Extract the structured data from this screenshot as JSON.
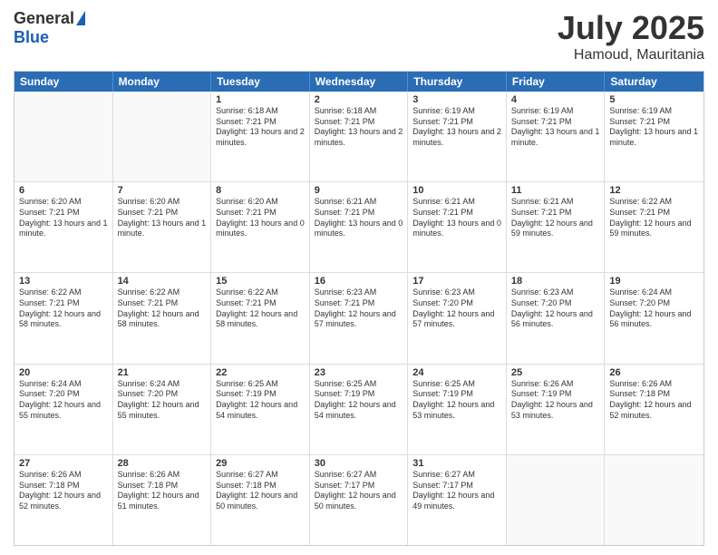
{
  "logo": {
    "general": "General",
    "blue": "Blue"
  },
  "title": "July 2025",
  "subtitle": "Hamoud, Mauritania",
  "header": {
    "days": [
      "Sunday",
      "Monday",
      "Tuesday",
      "Wednesday",
      "Thursday",
      "Friday",
      "Saturday"
    ]
  },
  "rows": [
    [
      {
        "day": "",
        "info": ""
      },
      {
        "day": "",
        "info": ""
      },
      {
        "day": "1",
        "info": "Sunrise: 6:18 AM\nSunset: 7:21 PM\nDaylight: 13 hours and 2 minutes."
      },
      {
        "day": "2",
        "info": "Sunrise: 6:18 AM\nSunset: 7:21 PM\nDaylight: 13 hours and 2 minutes."
      },
      {
        "day": "3",
        "info": "Sunrise: 6:19 AM\nSunset: 7:21 PM\nDaylight: 13 hours and 2 minutes."
      },
      {
        "day": "4",
        "info": "Sunrise: 6:19 AM\nSunset: 7:21 PM\nDaylight: 13 hours and 1 minute."
      },
      {
        "day": "5",
        "info": "Sunrise: 6:19 AM\nSunset: 7:21 PM\nDaylight: 13 hours and 1 minute."
      }
    ],
    [
      {
        "day": "6",
        "info": "Sunrise: 6:20 AM\nSunset: 7:21 PM\nDaylight: 13 hours and 1 minute."
      },
      {
        "day": "7",
        "info": "Sunrise: 6:20 AM\nSunset: 7:21 PM\nDaylight: 13 hours and 1 minute."
      },
      {
        "day": "8",
        "info": "Sunrise: 6:20 AM\nSunset: 7:21 PM\nDaylight: 13 hours and 0 minutes."
      },
      {
        "day": "9",
        "info": "Sunrise: 6:21 AM\nSunset: 7:21 PM\nDaylight: 13 hours and 0 minutes."
      },
      {
        "day": "10",
        "info": "Sunrise: 6:21 AM\nSunset: 7:21 PM\nDaylight: 13 hours and 0 minutes."
      },
      {
        "day": "11",
        "info": "Sunrise: 6:21 AM\nSunset: 7:21 PM\nDaylight: 12 hours and 59 minutes."
      },
      {
        "day": "12",
        "info": "Sunrise: 6:22 AM\nSunset: 7:21 PM\nDaylight: 12 hours and 59 minutes."
      }
    ],
    [
      {
        "day": "13",
        "info": "Sunrise: 6:22 AM\nSunset: 7:21 PM\nDaylight: 12 hours and 58 minutes."
      },
      {
        "day": "14",
        "info": "Sunrise: 6:22 AM\nSunset: 7:21 PM\nDaylight: 12 hours and 58 minutes."
      },
      {
        "day": "15",
        "info": "Sunrise: 6:22 AM\nSunset: 7:21 PM\nDaylight: 12 hours and 58 minutes."
      },
      {
        "day": "16",
        "info": "Sunrise: 6:23 AM\nSunset: 7:21 PM\nDaylight: 12 hours and 57 minutes."
      },
      {
        "day": "17",
        "info": "Sunrise: 6:23 AM\nSunset: 7:20 PM\nDaylight: 12 hours and 57 minutes."
      },
      {
        "day": "18",
        "info": "Sunrise: 6:23 AM\nSunset: 7:20 PM\nDaylight: 12 hours and 56 minutes."
      },
      {
        "day": "19",
        "info": "Sunrise: 6:24 AM\nSunset: 7:20 PM\nDaylight: 12 hours and 56 minutes."
      }
    ],
    [
      {
        "day": "20",
        "info": "Sunrise: 6:24 AM\nSunset: 7:20 PM\nDaylight: 12 hours and 55 minutes."
      },
      {
        "day": "21",
        "info": "Sunrise: 6:24 AM\nSunset: 7:20 PM\nDaylight: 12 hours and 55 minutes."
      },
      {
        "day": "22",
        "info": "Sunrise: 6:25 AM\nSunset: 7:19 PM\nDaylight: 12 hours and 54 minutes."
      },
      {
        "day": "23",
        "info": "Sunrise: 6:25 AM\nSunset: 7:19 PM\nDaylight: 12 hours and 54 minutes."
      },
      {
        "day": "24",
        "info": "Sunrise: 6:25 AM\nSunset: 7:19 PM\nDaylight: 12 hours and 53 minutes."
      },
      {
        "day": "25",
        "info": "Sunrise: 6:26 AM\nSunset: 7:19 PM\nDaylight: 12 hours and 53 minutes."
      },
      {
        "day": "26",
        "info": "Sunrise: 6:26 AM\nSunset: 7:18 PM\nDaylight: 12 hours and 52 minutes."
      }
    ],
    [
      {
        "day": "27",
        "info": "Sunrise: 6:26 AM\nSunset: 7:18 PM\nDaylight: 12 hours and 52 minutes."
      },
      {
        "day": "28",
        "info": "Sunrise: 6:26 AM\nSunset: 7:18 PM\nDaylight: 12 hours and 51 minutes."
      },
      {
        "day": "29",
        "info": "Sunrise: 6:27 AM\nSunset: 7:18 PM\nDaylight: 12 hours and 50 minutes."
      },
      {
        "day": "30",
        "info": "Sunrise: 6:27 AM\nSunset: 7:17 PM\nDaylight: 12 hours and 50 minutes."
      },
      {
        "day": "31",
        "info": "Sunrise: 6:27 AM\nSunset: 7:17 PM\nDaylight: 12 hours and 49 minutes."
      },
      {
        "day": "",
        "info": ""
      },
      {
        "day": "",
        "info": ""
      }
    ]
  ]
}
